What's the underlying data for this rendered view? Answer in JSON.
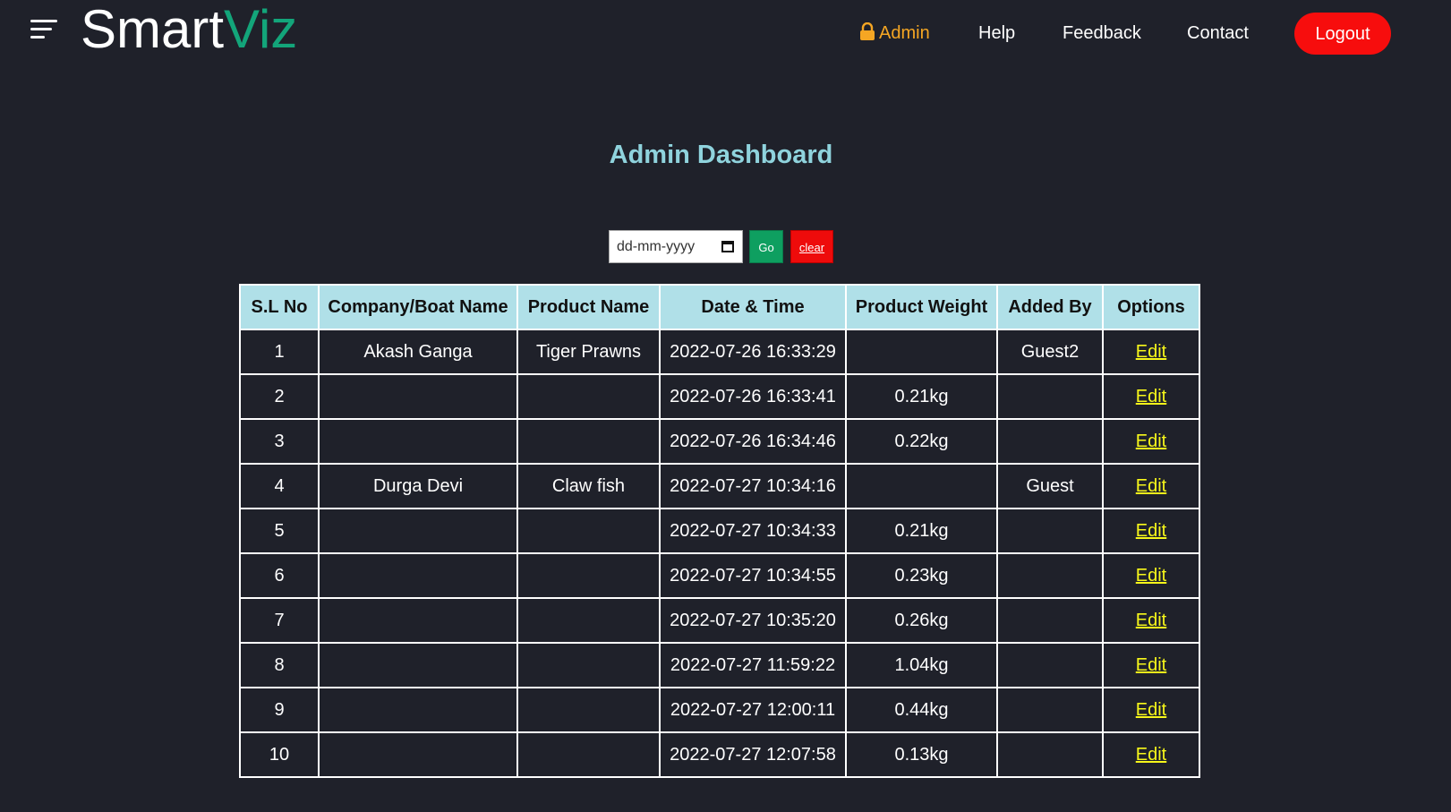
{
  "brand": {
    "part1": "Smart",
    "part2": "Viz"
  },
  "nav": {
    "admin": "Admin",
    "help": "Help",
    "feedback": "Feedback",
    "contact": "Contact",
    "logout": "Logout"
  },
  "page_title": "Admin Dashboard",
  "filter": {
    "date_placeholder": "dd-mm-yyyy",
    "go_label": "Go",
    "clear_label": "clear"
  },
  "table": {
    "headers": [
      "S.L No",
      "Company/Boat Name",
      "Product Name",
      "Date & Time",
      "Product Weight",
      "Added By",
      "Options"
    ],
    "rows": [
      [
        "1",
        "Akash Ganga",
        "Tiger Prawns",
        "2022-07-26 16:33:29",
        "",
        "Guest2",
        "Edit"
      ],
      [
        "2",
        "",
        "",
        "2022-07-26 16:33:41",
        "0.21kg",
        "",
        "Edit"
      ],
      [
        "3",
        "",
        "",
        "2022-07-26 16:34:46",
        "0.22kg",
        "",
        "Edit"
      ],
      [
        "4",
        "Durga Devi",
        "Claw fish",
        "2022-07-27 10:34:16",
        "",
        "Guest",
        "Edit"
      ],
      [
        "5",
        "",
        "",
        "2022-07-27 10:34:33",
        "0.21kg",
        "",
        "Edit"
      ],
      [
        "6",
        "",
        "",
        "2022-07-27 10:34:55",
        "0.23kg",
        "",
        "Edit"
      ],
      [
        "7",
        "",
        "",
        "2022-07-27 10:35:20",
        "0.26kg",
        "",
        "Edit"
      ],
      [
        "8",
        "",
        "",
        "2022-07-27 11:59:22",
        "1.04kg",
        "",
        "Edit"
      ],
      [
        "9",
        "",
        "",
        "2022-07-27 12:00:11",
        "0.44kg",
        "",
        "Edit"
      ],
      [
        "10",
        "",
        "",
        "2022-07-27 12:07:58",
        "0.13kg",
        "",
        "Edit"
      ]
    ]
  },
  "colors": {
    "background": "#1f212a",
    "brand_accent": "#13a57a",
    "admin_link": "#f5a623",
    "logout": "#f70d0d",
    "title": "#8fd3dd",
    "table_header": "#b0e0e8",
    "edit_link": "#f7f71a",
    "go_button": "#0e9f60",
    "clear_button": "#ee0b0b"
  },
  "icons": {
    "menu": "hamburger-menu-icon",
    "lock": "lock-icon",
    "calendar": "calendar-icon"
  }
}
